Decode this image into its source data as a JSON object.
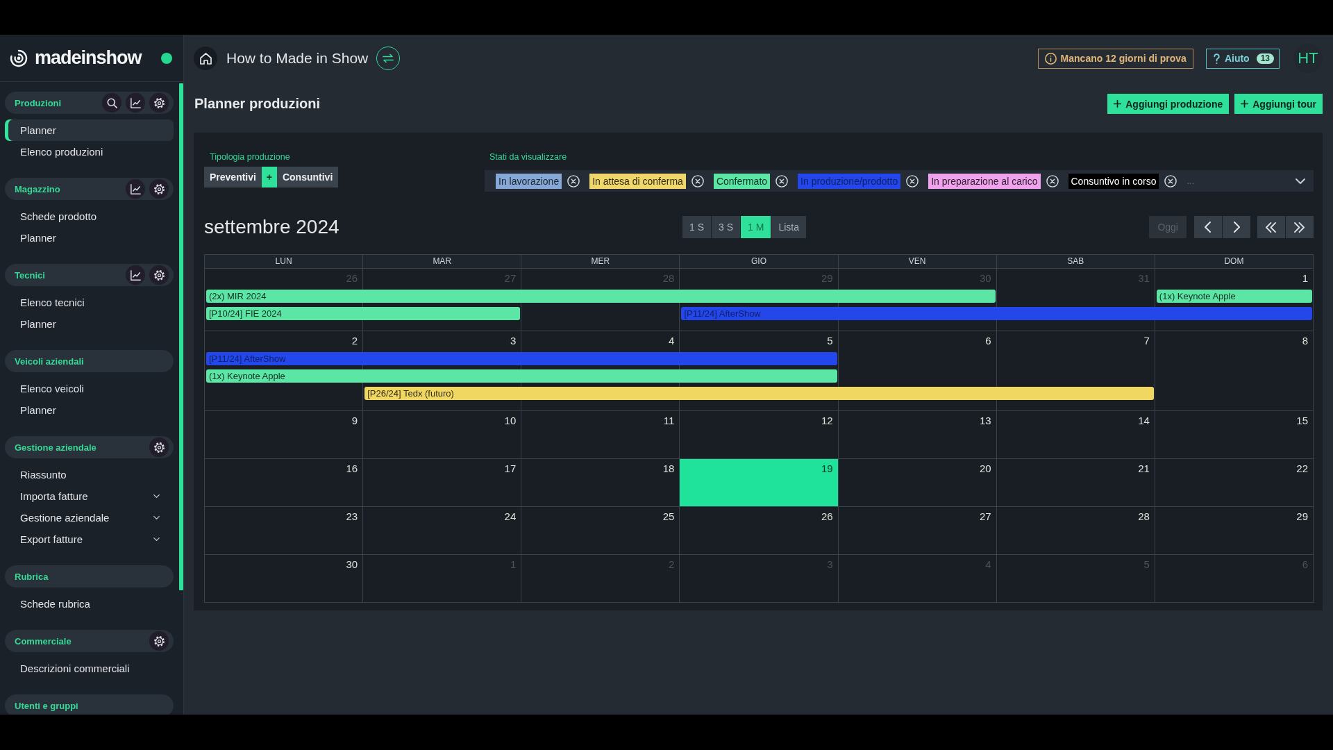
{
  "sidebar": {
    "logo": "madeinshow",
    "online": true,
    "sections": [
      {
        "title": "Produzioni",
        "actions": [
          {
            "kind": "search"
          },
          {
            "kind": "chart"
          },
          {
            "kind": "settings"
          }
        ],
        "items": [
          {
            "label": "Planner",
            "kind": "link",
            "selected": true
          },
          {
            "label": "Elenco produzioni",
            "kind": "link",
            "selected": false
          }
        ]
      },
      {
        "title": "Magazzino",
        "actions": [
          {
            "kind": "chart"
          },
          {
            "kind": "settings"
          }
        ],
        "items": [
          {
            "label": "Schede prodotto",
            "kind": "link",
            "selected": false
          },
          {
            "label": "Planner",
            "kind": "link",
            "selected": false
          }
        ]
      },
      {
        "title": "Tecnici",
        "actions": [
          {
            "kind": "chart"
          },
          {
            "kind": "settings"
          }
        ],
        "items": [
          {
            "label": "Elenco tecnici",
            "kind": "link",
            "selected": false
          },
          {
            "label": "Planner",
            "kind": "link",
            "selected": false
          }
        ]
      },
      {
        "title": "Veicoli aziendali",
        "items": [
          {
            "label": "Elenco veicoli",
            "kind": "link",
            "selected": false
          },
          {
            "label": "Planner",
            "kind": "link",
            "selected": false
          }
        ]
      },
      {
        "title": "Gestione aziendale",
        "actions": [
          {
            "kind": "settings"
          }
        ],
        "items": [
          {
            "label": "Riassunto",
            "kind": "link",
            "selected": false
          },
          {
            "label": "Importa fatture",
            "kind": "submenu",
            "selected": false
          },
          {
            "label": "Gestione aziendale",
            "kind": "submenu",
            "selected": false
          },
          {
            "label": "Export fatture",
            "kind": "submenu",
            "selected": false
          }
        ]
      },
      {
        "title": "Rubrica",
        "items": [
          {
            "label": "Schede rubrica",
            "kind": "link",
            "selected": false
          }
        ]
      },
      {
        "title": "Commerciale",
        "actions": [
          {
            "kind": "settings"
          }
        ],
        "items": [
          {
            "label": "Descrizioni commerciali",
            "kind": "link",
            "selected": false
          }
        ]
      },
      {
        "title": "Utenti e gruppi"
      }
    ]
  },
  "topbar": {
    "title": "How to Made in Show",
    "trial_notice": "Mancano 12 giorni di prova",
    "help": {
      "label": "Aiuto",
      "count": "13"
    },
    "avatar": "HT"
  },
  "page": {
    "title": "Planner produzioni",
    "buttons": [
      {
        "label": "Aggiungi produzione"
      },
      {
        "label": "Aggiungi tour"
      }
    ]
  },
  "filters": {
    "type": {
      "label": "Tipologia produzione",
      "options": [
        {
          "label": "Preventivi",
          "kind": "option"
        },
        {
          "label": "+",
          "kind": "join"
        },
        {
          "label": "Consuntivi",
          "kind": "option"
        }
      ]
    },
    "states": {
      "label": "Stati da visualizzare",
      "tags": [
        {
          "label": "In lavorazione",
          "color": "#86a8d6"
        },
        {
          "label": "In attesa di conferma",
          "color": "#f0d76c"
        },
        {
          "label": "Confermato",
          "color": "#5ce6a6"
        },
        {
          "label": "In produzione/prodotto",
          "color": "#2347ea"
        },
        {
          "label": "In preparazione al carico",
          "color": "#f0a3ec"
        },
        {
          "label": "Consuntivo in corso",
          "color": "#000000"
        }
      ],
      "more": "..."
    }
  },
  "calendar": {
    "month": "settembre 2024",
    "views": [
      {
        "label": "1 S",
        "selected": false
      },
      {
        "label": "3 S",
        "selected": false
      },
      {
        "label": "1 M",
        "selected": true
      },
      {
        "label": "Lista",
        "selected": false
      }
    ],
    "today_button": {
      "label": "Oggi",
      "disabled": true
    },
    "weekdays": [
      "LUN",
      "MAR",
      "MER",
      "GIO",
      "VEN",
      "SAB",
      "DOM"
    ],
    "weeks": [
      {
        "days": [
          {
            "day": "26",
            "outside": true,
            "today": false,
            "events": [
              {
                "kind": "start",
                "label": "(2x) MIR 2024",
                "color": "#5ce6a6"
              },
              {
                "kind": "start",
                "label": "[P10/24] FIE 2024",
                "color": "#5ce6a6"
              }
            ]
          },
          {
            "day": "27",
            "outside": true,
            "today": false,
            "events": [
              {
                "kind": "continue"
              },
              {
                "kind": "continue"
              }
            ]
          },
          {
            "day": "28",
            "outside": true,
            "today": false,
            "events": [
              {
                "kind": "continue"
              }
            ]
          },
          {
            "day": "29",
            "outside": true,
            "today": false,
            "events": [
              {
                "kind": "continue"
              },
              {
                "kind": "start",
                "label": "[P11/24] AfterShow",
                "color": "#2347ea"
              }
            ]
          },
          {
            "day": "30",
            "outside": true,
            "today": false,
            "events": [
              {
                "kind": "continue"
              },
              {
                "kind": "continue"
              }
            ]
          },
          {
            "day": "31",
            "outside": true,
            "today": false,
            "events": [
              {
                "kind": "none"
              },
              {
                "kind": "continue"
              }
            ]
          },
          {
            "day": "1",
            "outside": false,
            "today": false,
            "events": [
              {
                "kind": "start",
                "label": "(1x) Keynote Apple",
                "color": "#5ce6a6"
              },
              {
                "kind": "continue"
              }
            ]
          }
        ]
      },
      {
        "days": [
          {
            "day": "2",
            "outside": false,
            "today": false,
            "events": [
              {
                "kind": "start",
                "label": "[P11/24] AfterShow",
                "color": "#2347ea"
              },
              {
                "kind": "start",
                "label": "(1x) Keynote Apple",
                "color": "#5ce6a6"
              }
            ]
          },
          {
            "day": "3",
            "outside": false,
            "today": false,
            "events": [
              {
                "kind": "continue"
              },
              {
                "kind": "continue"
              },
              {
                "kind": "start",
                "label": "[P26/24] Tedx (futuro)",
                "color": "#efd762"
              }
            ]
          },
          {
            "day": "4",
            "outside": false,
            "today": false,
            "events": [
              {
                "kind": "continue"
              },
              {
                "kind": "continue"
              },
              {
                "kind": "continue"
              }
            ]
          },
          {
            "day": "5",
            "outside": false,
            "today": false,
            "events": [
              {
                "kind": "continue"
              },
              {
                "kind": "continue"
              },
              {
                "kind": "continue"
              }
            ]
          },
          {
            "day": "6",
            "outside": false,
            "today": false,
            "events": [
              {
                "kind": "none"
              },
              {
                "kind": "none"
              },
              {
                "kind": "continue"
              }
            ]
          },
          {
            "day": "7",
            "outside": false,
            "today": false,
            "events": [
              {
                "kind": "none"
              },
              {
                "kind": "none"
              },
              {
                "kind": "continue"
              }
            ]
          },
          {
            "day": "8",
            "outside": false,
            "today": false
          }
        ]
      },
      {
        "days": [
          {
            "day": "9",
            "outside": false,
            "today": false
          },
          {
            "day": "10",
            "outside": false,
            "today": false
          },
          {
            "day": "11",
            "outside": false,
            "today": false
          },
          {
            "day": "12",
            "outside": false,
            "today": false
          },
          {
            "day": "13",
            "outside": false,
            "today": false
          },
          {
            "day": "14",
            "outside": false,
            "today": false
          },
          {
            "day": "15",
            "outside": false,
            "today": false
          }
        ]
      },
      {
        "days": [
          {
            "day": "16",
            "outside": false,
            "today": false
          },
          {
            "day": "17",
            "outside": false,
            "today": false
          },
          {
            "day": "18",
            "outside": false,
            "today": false
          },
          {
            "day": "19",
            "outside": false,
            "today": true
          },
          {
            "day": "20",
            "outside": false,
            "today": false
          },
          {
            "day": "21",
            "outside": false,
            "today": false
          },
          {
            "day": "22",
            "outside": false,
            "today": false
          }
        ]
      },
      {
        "days": [
          {
            "day": "23",
            "outside": false,
            "today": false
          },
          {
            "day": "24",
            "outside": false,
            "today": false
          },
          {
            "day": "25",
            "outside": false,
            "today": false
          },
          {
            "day": "26",
            "outside": false,
            "today": false
          },
          {
            "day": "27",
            "outside": false,
            "today": false
          },
          {
            "day": "28",
            "outside": false,
            "today": false
          },
          {
            "day": "29",
            "outside": false,
            "today": false
          }
        ]
      },
      {
        "days": [
          {
            "day": "30",
            "outside": false,
            "today": false
          },
          {
            "day": "1",
            "outside": true,
            "today": false
          },
          {
            "day": "2",
            "outside": true,
            "today": false
          },
          {
            "day": "3",
            "outside": true,
            "today": false
          },
          {
            "day": "4",
            "outside": true,
            "today": false
          },
          {
            "day": "5",
            "outside": true,
            "today": false
          },
          {
            "day": "6",
            "outside": true,
            "today": false
          }
        ]
      }
    ]
  }
}
